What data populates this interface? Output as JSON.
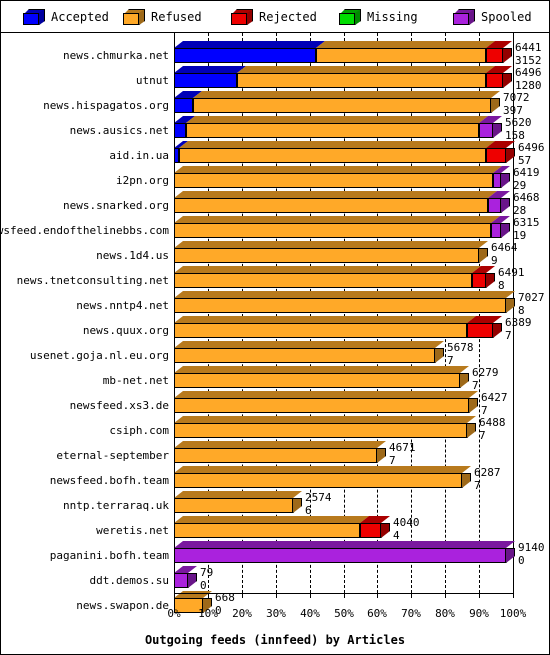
{
  "legend": {
    "items": [
      {
        "label": "Accepted",
        "color": "#0000ff",
        "icon": "cube-icon"
      },
      {
        "label": "Refused",
        "color": "#ffa928",
        "icon": "cube-icon"
      },
      {
        "label": "Rejected",
        "color": "#ee0000",
        "icon": "cube-icon"
      },
      {
        "label": "Missing",
        "color": "#00dd00",
        "icon": "cube-icon"
      },
      {
        "label": "Spooled",
        "color": "#aa22dd",
        "icon": "cube-icon"
      }
    ]
  },
  "axis": {
    "xlabel": "Outgoing feeds (innfeed) by Articles",
    "ticks": [
      "0%",
      "10%",
      "20%",
      "30%",
      "40%",
      "50%",
      "60%",
      "70%",
      "80%",
      "90%",
      "100%"
    ]
  },
  "chart_data": {
    "type": "bar",
    "title": "Outgoing feeds (innfeed) by Articles",
    "subtitle": "",
    "orientation": "horizontal",
    "stacked": true,
    "normalized_percent": true,
    "xlabel": "Outgoing feeds (innfeed) by Articles",
    "ylabel": "",
    "xlim": [
      0,
      100
    ],
    "xticks": [
      0,
      10,
      20,
      30,
      40,
      50,
      60,
      70,
      80,
      90,
      100
    ],
    "xticklabels": [
      "0%",
      "10%",
      "20%",
      "30%",
      "40%",
      "50%",
      "60%",
      "70%",
      "80%",
      "90%",
      "100%"
    ],
    "grid": true,
    "legend_position": "top",
    "legend_entries": [
      "Accepted",
      "Refused",
      "Rejected",
      "Missing",
      "Spooled"
    ],
    "series_colors": [
      "#0000ff",
      "#ffa928",
      "#ee0000",
      "#00dd00",
      "#aa22dd"
    ],
    "categories": [
      "news.chmurka.net",
      "utnut",
      "news.hispagatos.org",
      "news.ausics.net",
      "aid.in.ua",
      "i2pn.org",
      "news.snarked.org",
      "newsfeed.endofthelinebbs.com",
      "news.1d4.us",
      "news.tnetconsulting.net",
      "news.nntp4.net",
      "news.quux.org",
      "usenet.goja.nl.eu.org",
      "mb-net.net",
      "newsfeed.xs3.de",
      "csiph.com",
      "eternal-september",
      "newsfeed.bofh.team",
      "nntp.terraraq.uk",
      "weretis.net",
      "paganini.bofh.team",
      "ddt.demos.su",
      "news.swapon.de"
    ],
    "value_labels": [
      {
        "top": "6441",
        "bottom": "3152"
      },
      {
        "top": "6496",
        "bottom": "1280"
      },
      {
        "top": "7072",
        "bottom": "397"
      },
      {
        "top": "5620",
        "bottom": "158"
      },
      {
        "top": "6496",
        "bottom": "57"
      },
      {
        "top": "6419",
        "bottom": "29"
      },
      {
        "top": "6468",
        "bottom": "28"
      },
      {
        "top": "6315",
        "bottom": "19"
      },
      {
        "top": "6464",
        "bottom": "9"
      },
      {
        "top": "6491",
        "bottom": "8"
      },
      {
        "top": "7027",
        "bottom": "8"
      },
      {
        "top": "6389",
        "bottom": "7"
      },
      {
        "top": "5678",
        "bottom": "7"
      },
      {
        "top": "6279",
        "bottom": "7"
      },
      {
        "top": "6427",
        "bottom": "7"
      },
      {
        "top": "6488",
        "bottom": "7"
      },
      {
        "top": "4671",
        "bottom": "7"
      },
      {
        "top": "6287",
        "bottom": "7"
      },
      {
        "top": "2574",
        "bottom": "6"
      },
      {
        "top": "4040",
        "bottom": "4"
      },
      {
        "top": "9140",
        "bottom": "0"
      },
      {
        "top": "79",
        "bottom": "0"
      },
      {
        "top": "668",
        "bottom": "0"
      }
    ],
    "series": [
      {
        "name": "Accepted",
        "color": "#0000ff",
        "values": [
          42.0,
          18.5,
          5.5,
          3.5,
          1.5,
          0.0,
          0.0,
          0.0,
          0.0,
          0.0,
          0.0,
          0.0,
          0.0,
          0.0,
          0.0,
          0.0,
          0.0,
          0.0,
          0.0,
          0.0,
          0.0,
          0.0,
          0.0
        ]
      },
      {
        "name": "Refused",
        "color": "#ffa928",
        "values": [
          50.0,
          73.5,
          88.0,
          86.5,
          90.5,
          94.0,
          92.5,
          93.5,
          90.0,
          88.0,
          98.0,
          86.5,
          77.0,
          84.5,
          87.0,
          86.5,
          60.0,
          85.0,
          35.0,
          55.0,
          0.0,
          0.0,
          8.5
        ]
      },
      {
        "name": "Rejected",
        "color": "#ee0000",
        "values": [
          5.0,
          5.0,
          0.0,
          0.0,
          6.0,
          0.0,
          0.0,
          0.0,
          0.0,
          4.0,
          0.0,
          7.5,
          0.0,
          0.0,
          0.0,
          0.0,
          0.0,
          0.0,
          0.0,
          6.0,
          0.0,
          0.0,
          0.0
        ]
      },
      {
        "name": "Missing",
        "color": "#00dd00",
        "values": [
          0.0,
          0.0,
          0.0,
          0.0,
          0.0,
          0.0,
          0.0,
          0.0,
          0.0,
          0.0,
          0.0,
          0.0,
          0.0,
          0.0,
          0.0,
          0.0,
          0.0,
          0.0,
          0.0,
          0.0,
          0.0,
          0.0,
          0.0
        ]
      },
      {
        "name": "Spooled",
        "color": "#aa22dd",
        "values": [
          0.0,
          0.0,
          0.0,
          4.0,
          0.0,
          2.5,
          4.0,
          3.0,
          0.0,
          0.0,
          0.0,
          0.0,
          0.0,
          0.0,
          0.0,
          0.0,
          0.0,
          0.0,
          0.0,
          0.0,
          98.0,
          4.0,
          0.0
        ]
      }
    ]
  }
}
